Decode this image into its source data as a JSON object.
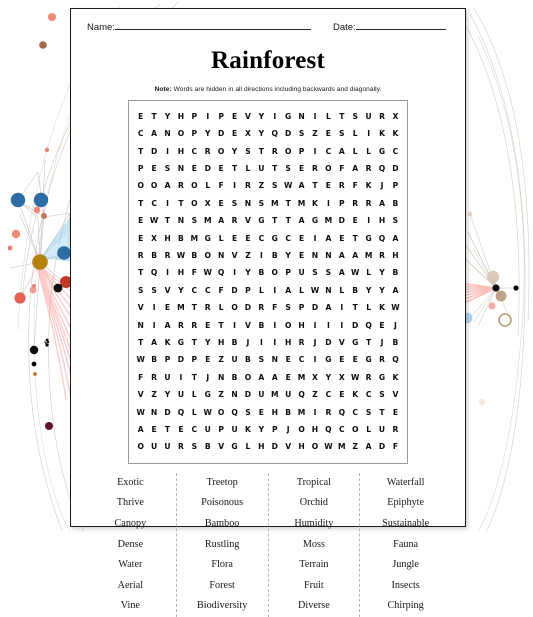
{
  "header": {
    "name_label": "Name:",
    "date_label": "Date:"
  },
  "title": "Rainforest",
  "note": {
    "prefix": "Note:",
    "text": " Words are hidden in all directions including backwards and diagonally."
  },
  "grid": {
    "rows": 20,
    "cols": 18,
    "letters": [
      [
        "E",
        "T",
        "Y",
        "H",
        "P",
        "I",
        "P",
        "E",
        "V",
        "Y",
        "I",
        "G",
        "N",
        "I",
        "L",
        "T",
        "S",
        "U",
        "R",
        "X"
      ],
      [
        "C",
        "A",
        "N",
        "O",
        "P",
        "Y",
        "D",
        "E",
        "X",
        "Y",
        "Q",
        "D",
        "S",
        "Z",
        "E",
        "S",
        "L",
        "I",
        "K",
        "K"
      ],
      [
        "T",
        "D",
        "I",
        "H",
        "C",
        "R",
        "O",
        "Y",
        "S",
        "T",
        "R",
        "O",
        "P",
        "I",
        "C",
        "A",
        "L",
        "L",
        "G",
        "C"
      ],
      [
        "P",
        "E",
        "S",
        "N",
        "E",
        "D",
        "E",
        "T",
        "L",
        "U",
        "T",
        "S",
        "E",
        "R",
        "O",
        "F",
        "A",
        "R",
        "Q",
        "D"
      ],
      [
        "O",
        "O",
        "A",
        "R",
        "O",
        "L",
        "F",
        "I",
        "R",
        "Z",
        "S",
        "W",
        "A",
        "T",
        "E",
        "R",
        "F",
        "K",
        "J",
        "P"
      ],
      [
        "T",
        "C",
        "I",
        "T",
        "O",
        "X",
        "E",
        "S",
        "N",
        "S",
        "M",
        "T",
        "M",
        "K",
        "I",
        "P",
        "R",
        "R",
        "A",
        "B"
      ],
      [
        "E",
        "W",
        "T",
        "N",
        "S",
        "M",
        "A",
        "R",
        "V",
        "G",
        "T",
        "T",
        "A",
        "G",
        "M",
        "D",
        "E",
        "I",
        "H",
        "S"
      ],
      [
        "E",
        "X",
        "H",
        "B",
        "M",
        "G",
        "L",
        "E",
        "E",
        "C",
        "G",
        "C",
        "E",
        "I",
        "A",
        "E",
        "T",
        "G",
        "Q",
        "A"
      ],
      [
        "R",
        "B",
        "R",
        "W",
        "B",
        "O",
        "N",
        "V",
        "Z",
        "I",
        "B",
        "Y",
        "E",
        "N",
        "N",
        "A",
        "A",
        "M",
        "R",
        "H"
      ],
      [
        "T",
        "Q",
        "I",
        "H",
        "F",
        "W",
        "Q",
        "I",
        "Y",
        "B",
        "O",
        "P",
        "U",
        "S",
        "S",
        "A",
        "W",
        "L",
        "Y",
        "B"
      ],
      [
        "S",
        "S",
        "V",
        "Y",
        "C",
        "C",
        "F",
        "D",
        "P",
        "L",
        "I",
        "A",
        "L",
        "W",
        "N",
        "L",
        "B",
        "Y",
        "Y",
        "A"
      ],
      [
        "V",
        "I",
        "E",
        "M",
        "T",
        "R",
        "L",
        "O",
        "D",
        "R",
        "F",
        "S",
        "P",
        "D",
        "A",
        "I",
        "T",
        "L",
        "K",
        "W"
      ],
      [
        "N",
        "I",
        "A",
        "R",
        "R",
        "E",
        "T",
        "I",
        "V",
        "B",
        "I",
        "O",
        "H",
        "I",
        "I",
        "I",
        "D",
        "Q",
        "E",
        "J"
      ],
      [
        "T",
        "A",
        "K",
        "G",
        "T",
        "Y",
        "H",
        "B",
        "J",
        "I",
        "I",
        "H",
        "R",
        "J",
        "D",
        "V",
        "G",
        "T",
        "J",
        "B"
      ],
      [
        "W",
        "B",
        "P",
        "D",
        "P",
        "E",
        "Z",
        "U",
        "B",
        "S",
        "N",
        "E",
        "C",
        "I",
        "G",
        "E",
        "E",
        "G",
        "R",
        "Q"
      ],
      [
        "F",
        "R",
        "U",
        "I",
        "T",
        "J",
        "N",
        "B",
        "O",
        "A",
        "A",
        "E",
        "M",
        "X",
        "Y",
        "X",
        "W",
        "R",
        "G",
        "K"
      ],
      [
        "V",
        "Z",
        "Y",
        "U",
        "L",
        "G",
        "Z",
        "N",
        "D",
        "U",
        "M",
        "U",
        "Q",
        "Z",
        "C",
        "E",
        "K",
        "C",
        "S",
        "V"
      ],
      [
        "W",
        "N",
        "D",
        "Q",
        "L",
        "W",
        "O",
        "Q",
        "S",
        "E",
        "H",
        "B",
        "M",
        "I",
        "R",
        "Q",
        "C",
        "S",
        "T",
        "E"
      ],
      [
        "A",
        "E",
        "T",
        "E",
        "C",
        "U",
        "P",
        "U",
        "K",
        "Y",
        "P",
        "J",
        "O",
        "H",
        "Q",
        "C",
        "O",
        "L",
        "U",
        "R"
      ],
      [
        "O",
        "U",
        "U",
        "R",
        "S",
        "B",
        "V",
        "G",
        "L",
        "H",
        "D",
        "V",
        "H",
        "O",
        "W",
        "M",
        "Z",
        "A",
        "D",
        "F"
      ]
    ]
  },
  "word_list": {
    "columns": [
      [
        "Exotic",
        "Thrive",
        "Canopy",
        "Dense",
        "Water",
        "Aerial",
        "Vine"
      ],
      [
        "Treetop",
        "Poisonous",
        "Bamboo",
        "Rustling",
        "Flora",
        "Forest",
        "Biodiversity"
      ],
      [
        "Tropical",
        "Orchid",
        "Humidity",
        "Moss",
        "Terrain",
        "Fruit",
        "Diverse"
      ],
      [
        "Waterfall",
        "Epiphyte",
        "Sustainable",
        "Fauna",
        "Jungle",
        "Insects",
        "Chirping"
      ]
    ]
  },
  "decoration": {
    "node_colors": [
      "#2e6da4",
      "#3d7ebc",
      "#b5651d",
      "#c0392b",
      "#e8836f",
      "#111111",
      "#a36a4a",
      "#7f1d2e"
    ],
    "edge_color": "#c4a48f",
    "highlight_red": "#f4615a",
    "highlight_blue": "#7cc4e8"
  }
}
